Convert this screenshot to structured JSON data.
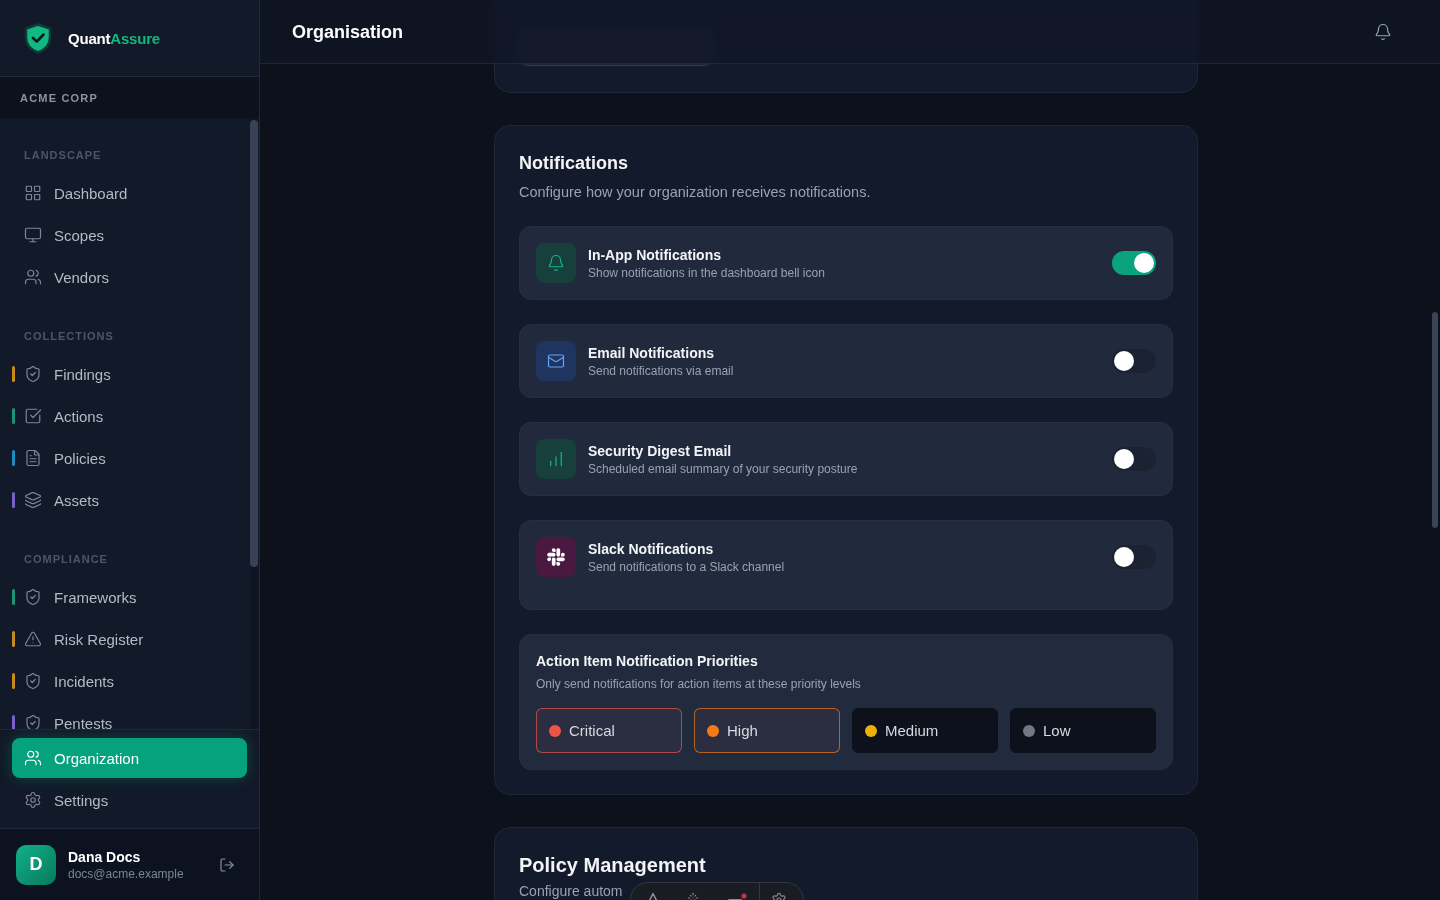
{
  "sidebar": {
    "brand": {
      "name": "Quant",
      "accent": "Assure"
    },
    "workspace": "ACME CORP",
    "sections": [
      {
        "title": "LANDSCAPE",
        "items": [
          {
            "label": "Dashboard",
            "selected": false
          },
          {
            "label": "Scopes",
            "selected": false
          },
          {
            "label": "Vendors",
            "selected": false
          }
        ]
      },
      {
        "title": "COLLECTIONS",
        "items": [
          {
            "label": "Findings",
            "color": "#c98a1c",
            "selected": false
          },
          {
            "label": "Actions",
            "color": "#1a9473",
            "selected": false
          },
          {
            "label": "Policies",
            "color": "#1a8cc0",
            "selected": false
          },
          {
            "label": "Assets",
            "color": "#7a60c8",
            "selected": false
          }
        ]
      },
      {
        "title": "COMPLIANCE",
        "items": [
          {
            "label": "Frameworks",
            "color": "#1a9473",
            "selected": false
          },
          {
            "label": "Risk Register",
            "color": "#c98a1c",
            "selected": false
          },
          {
            "label": "Incidents",
            "color": "#c98a1c",
            "selected": false
          },
          {
            "label": "Pentests",
            "color": "#7a60c8",
            "selected": false
          }
        ]
      }
    ],
    "bottom_items": [
      {
        "label": "Organization",
        "selected": true
      },
      {
        "label": "Settings",
        "selected": false
      }
    ],
    "user": {
      "initial": "D",
      "name": "Dana Docs",
      "email": "docs@acme.example"
    }
  },
  "header": {
    "title": "Organisation"
  },
  "notifications": {
    "title": "Notifications",
    "description": "Configure how your organization receives notifications.",
    "channels": [
      {
        "kind": "in_app",
        "title": "In-App Notifications",
        "description": "Show notifications in the dashboard bell icon",
        "on": true
      },
      {
        "kind": "email",
        "title": "Email Notifications",
        "description": "Send notifications via email",
        "on": false
      },
      {
        "kind": "digest",
        "title": "Security Digest Email",
        "description": "Scheduled email summary of your security posture",
        "on": false
      },
      {
        "kind": "slack",
        "title": "Slack Notifications",
        "description": "Send notifications to a Slack channel",
        "on": false
      }
    ],
    "priorities": {
      "title": "Action Item Notification Priorities",
      "description": "Only send notifications for action items at these priority levels",
      "levels": [
        {
          "label": "Critical",
          "color": "#f0524a",
          "selected": true
        },
        {
          "label": "High",
          "color": "#f57a15",
          "selected": true
        },
        {
          "label": "Medium",
          "color": "#eeb10a",
          "selected": false
        },
        {
          "label": "Low",
          "color": "#737886",
          "selected": false
        }
      ]
    }
  },
  "policy_management": {
    "title": "Policy Management",
    "description": "Configure autom"
  }
}
